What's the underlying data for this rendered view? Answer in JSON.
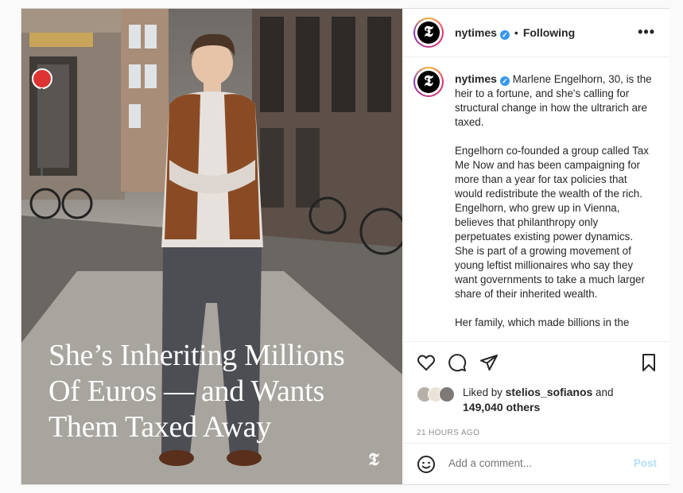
{
  "post": {
    "account": "nytimes",
    "verified_mark": "✓",
    "following_label": "Following",
    "separator": "•",
    "more_label": "•••",
    "avatar_glyph": "𝕿",
    "headline_lines": [
      "She’s Inheriting Millions",
      "Of Euros — and Wants",
      "Them Taxed Away"
    ],
    "photo_logo_glyph": "𝕿",
    "caption_paragraphs": [
      "Marlene Engelhorn, 30, is the heir to a fortune, and she's calling for structural change in how the ultrarich are taxed.",
      "Engelhorn co-founded a group called Tax Me Now and has been campaigning for more than a year for tax policies that would redistribute the wealth of the rich. Engelhorn, who grew up in Vienna, believes that philanthropy only perpetuates existing power dynamics. She is part of a growing movement of young leftist millionaires who say they want governments to take a much larger share of their inherited wealth.",
      "Her family, which made billions in the"
    ],
    "liked_prefix": "Liked by",
    "liked_by_user": "stelios_sofianos",
    "liked_and": "and",
    "liked_others": "149,040 others",
    "timestamp": "21 HOURS AGO",
    "comment_placeholder": "Add a comment...",
    "post_label": "Post"
  },
  "colors": {
    "accent_blue": "#3897f0",
    "post_disabled": "#b2dffc",
    "muted_text": "#8e8e8e"
  },
  "icons": [
    "heart-icon",
    "comment-icon",
    "share-icon",
    "bookmark-icon",
    "emoji-icon",
    "more-icon",
    "verified-icon"
  ]
}
